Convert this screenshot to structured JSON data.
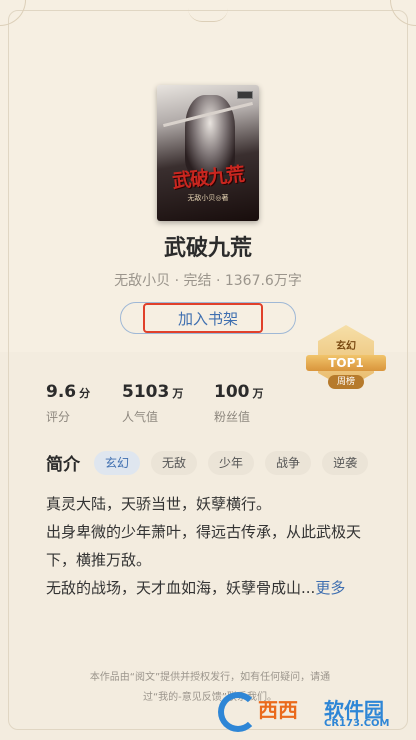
{
  "book": {
    "cover_title": "武破九荒",
    "cover_author": "无敌小贝◎著",
    "title": "武破九荒",
    "meta": "无敌小贝 · 完结 · 1367.6万字",
    "add_shelf_label": "加入书架"
  },
  "rank_badge": {
    "category": "玄幻",
    "rank": "TOP1",
    "period": "周榜"
  },
  "stats": [
    {
      "value": "9.6",
      "unit": "分",
      "label": "评分"
    },
    {
      "value": "5103",
      "unit": "万",
      "label": "人气值"
    },
    {
      "value": "100",
      "unit": "万",
      "label": "粉丝值"
    }
  ],
  "intro": {
    "title": "简介",
    "tags": [
      "玄幻",
      "无敌",
      "少年",
      "战争",
      "逆袭"
    ],
    "lines": [
      "真灵大陆，天骄当世，妖孽横行。",
      "出身卑微的少年萧叶，得远古传承，从此武极天下，横推万敌。",
      "无敌的战场，天才血如海，妖孽骨成山..."
    ],
    "more_label": "更多"
  },
  "footer": {
    "line1": "本作品由“阅文”提供并授权发行，如有任何疑问，请通",
    "line2": "过“我的-意见反馈”联系我们。"
  },
  "watermark": {
    "main": "西西",
    "brand": "软件园",
    "url": "CR173.COM"
  }
}
